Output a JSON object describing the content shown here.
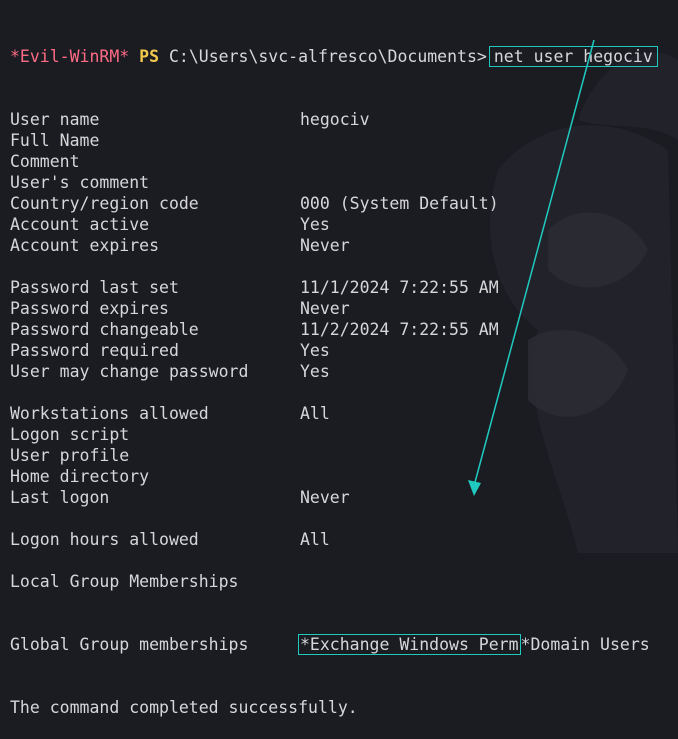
{
  "prompt": {
    "evil": "*Evil-WinRM*",
    "ps": "PS",
    "path": "C:\\Users\\svc-alfresco\\Documents>",
    "command": "net user hegociv"
  },
  "rows": [
    {
      "label": "User name",
      "value": "hegociv"
    },
    {
      "label": "Full Name",
      "value": ""
    },
    {
      "label": "Comment",
      "value": ""
    },
    {
      "label": "User's comment",
      "value": ""
    },
    {
      "label": "Country/region code",
      "value": "000 (System Default)"
    },
    {
      "label": "Account active",
      "value": "Yes"
    },
    {
      "label": "Account expires",
      "value": "Never"
    },
    {
      "label": "",
      "value": ""
    },
    {
      "label": "Password last set",
      "value": "11/1/2024 7:22:55 AM"
    },
    {
      "label": "Password expires",
      "value": "Never"
    },
    {
      "label": "Password changeable",
      "value": "11/2/2024 7:22:55 AM"
    },
    {
      "label": "Password required",
      "value": "Yes"
    },
    {
      "label": "User may change password",
      "value": "Yes"
    },
    {
      "label": "",
      "value": ""
    },
    {
      "label": "Workstations allowed",
      "value": "All"
    },
    {
      "label": "Logon script",
      "value": ""
    },
    {
      "label": "User profile",
      "value": ""
    },
    {
      "label": "Home directory",
      "value": ""
    },
    {
      "label": "Last logon",
      "value": "Never"
    },
    {
      "label": "",
      "value": ""
    },
    {
      "label": "Logon hours allowed",
      "value": "All"
    },
    {
      "label": "",
      "value": ""
    },
    {
      "label": "Local Group Memberships",
      "value": ""
    }
  ],
  "global_groups": {
    "label": "Global Group memberships",
    "highlighted": "*Exchange Windows Perm",
    "rest": "*Domain Users"
  },
  "completion": "The command completed successfully.",
  "colors": {
    "background": "#1b1c22",
    "text": "#d7d7da",
    "prompt_evil": "#ff6b84",
    "prompt_ps": "#f2c94c",
    "annotation": "#20c9c0"
  }
}
